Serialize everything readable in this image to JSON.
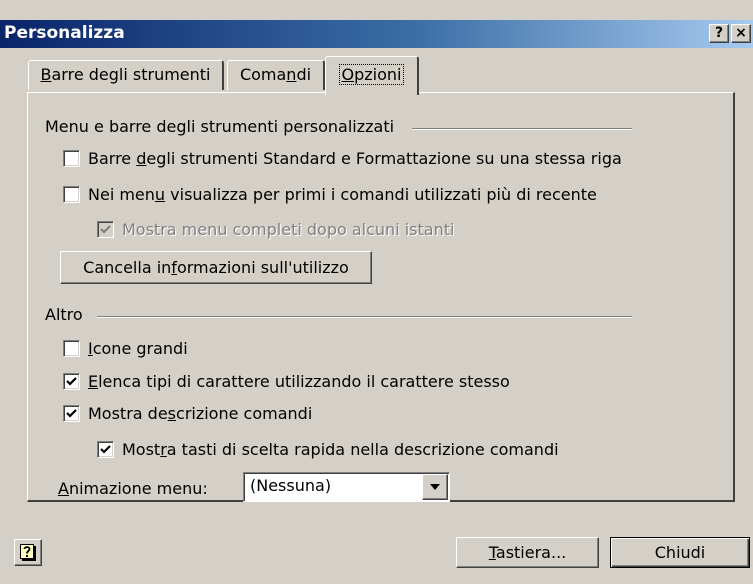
{
  "window": {
    "title": "Personalizza",
    "help_caption": "?",
    "close_caption": "×"
  },
  "tabs": [
    {
      "pre": "",
      "mnemonic": "B",
      "post": "arre degli strumenti"
    },
    {
      "pre": "Coma",
      "mnemonic": "n",
      "post": "di"
    },
    {
      "pre": "",
      "mnemonic": "O",
      "post": "pzioni"
    }
  ],
  "section_menu": {
    "header": "Menu e barre degli strumenti personalizzati",
    "options": [
      {
        "pre": "Barre ",
        "mnemonic": "d",
        "post": "egli strumenti Standard e Formattazione su una stessa riga",
        "checked": false,
        "enabled": true
      },
      {
        "pre": "Nei men",
        "mnemonic": "u",
        "post": " visualizza per primi i comandi utilizzati più di recente",
        "checked": false,
        "enabled": true
      },
      {
        "pre": "",
        "mnemonic": "",
        "post": "Mostra menu completi dopo alcuni istanti",
        "checked": true,
        "enabled": false
      }
    ],
    "reset_button": {
      "pre": "Cancella in",
      "mnemonic": "f",
      "post": "ormazioni sull'utilizzo"
    }
  },
  "section_other": {
    "header": "Altro",
    "options": [
      {
        "pre": "",
        "mnemonic": "I",
        "post": "cone grandi",
        "checked": false,
        "enabled": true
      },
      {
        "pre": "",
        "mnemonic": "E",
        "post": "lenca tipi di carattere utilizzando il carattere stesso",
        "checked": true,
        "enabled": true
      },
      {
        "pre": "Mostra de",
        "mnemonic": "s",
        "post": "crizione comandi",
        "checked": true,
        "enabled": true
      },
      {
        "pre": "Most",
        "mnemonic": "r",
        "post": "a tasti di scelta rapida nella descrizione comandi",
        "checked": true,
        "enabled": true
      }
    ],
    "animation": {
      "label_pre": "",
      "label_mnemonic": "A",
      "label_post": "nimazione menu:",
      "selected": "(Nessuna)"
    }
  },
  "footer": {
    "keyboard_button": {
      "pre": "",
      "mnemonic": "T",
      "post": "astiera..."
    },
    "close_button": "Chiudi"
  },
  "colors": {
    "face": "#d4d0c8",
    "title_start": "#0a246a",
    "title_end": "#a6caf0",
    "disabled_text": "#808080"
  }
}
